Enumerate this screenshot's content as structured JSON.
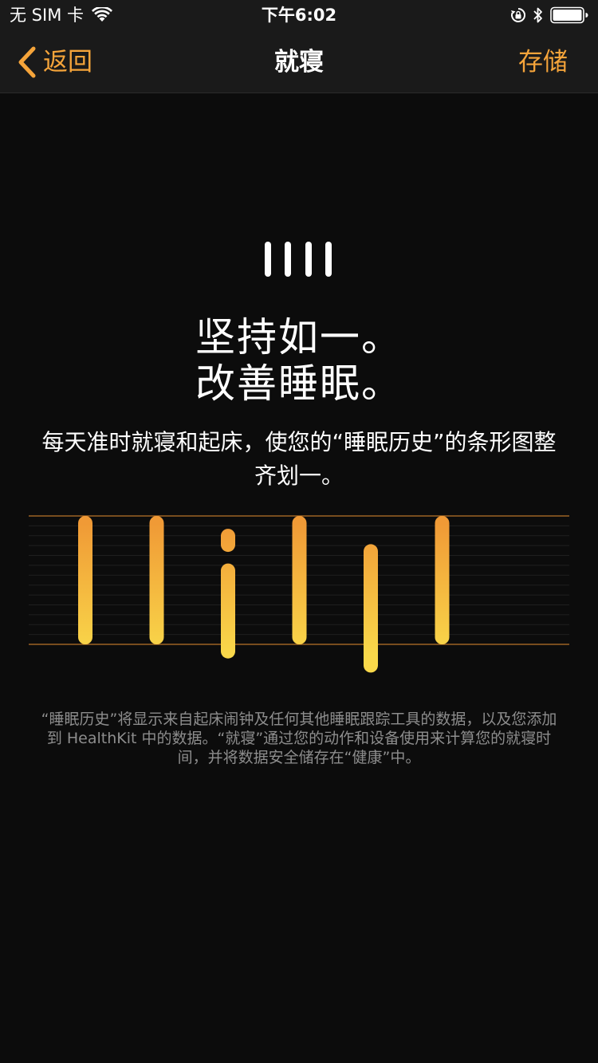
{
  "status_bar": {
    "carrier": "无 SIM 卡",
    "time": "下午6:02",
    "icons": [
      "wifi-icon",
      "lock-rotation-icon",
      "bluetooth-icon",
      "battery-icon"
    ]
  },
  "nav": {
    "back_label": "返回",
    "title": "就寝",
    "save_label": "存储"
  },
  "content": {
    "headline_line1": "坚持如一。",
    "headline_line2": "改善睡眠。",
    "subtitle": "每天准时就寝和起床，使您的“睡眠历史”的条形图整齐划一。",
    "footnote": "“睡眠历史”将显示来自起床闹钟及任何其他睡眠跟踪工具的数据，以及您添加到 HealthKit 中的数据。“就寝”通过您的动作和设备使用来计算您的就寝时间，并将数据安全储存在“健康”中。"
  },
  "illustration": {
    "icon": "bedtime-bars-icon",
    "bars": [
      {
        "segments": [
          [
            0.0,
            1.0
          ]
        ]
      },
      {
        "segments": [
          [
            0.0,
            1.0
          ]
        ]
      },
      {
        "segments": [
          [
            0.1,
            0.28
          ],
          [
            0.37,
            1.11
          ]
        ]
      },
      {
        "segments": [
          [
            0.0,
            1.0
          ]
        ]
      },
      {
        "segments": [
          [
            0.22,
            1.22
          ]
        ]
      },
      {
        "segments": [
          [
            0.0,
            1.0
          ]
        ]
      }
    ]
  },
  "colors": {
    "accent": "#f5a43a",
    "background": "#0c0c0c",
    "bar_top": "#f09a36",
    "bar_bottom": "#f9d84a",
    "footnote_text": "#8d8d8d",
    "guide_line": "#b8742a"
  }
}
